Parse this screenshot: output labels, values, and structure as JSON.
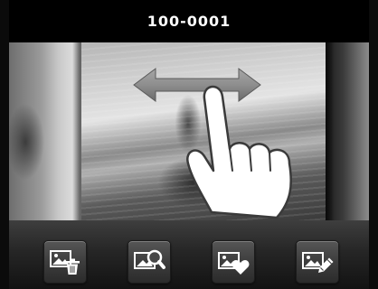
{
  "header": {
    "file_number": "100-0001"
  },
  "viewer": {
    "gesture": "swipe-left-right",
    "gesture_icons": [
      "double-arrow-icon",
      "pointing-hand-icon"
    ]
  },
  "toolbar": {
    "buttons": [
      {
        "name": "erase-image-button",
        "icon": "image-trash-icon"
      },
      {
        "name": "magnify-image-button",
        "icon": "image-magnify-icon"
      },
      {
        "name": "rate-image-button",
        "icon": "image-heart-icon"
      },
      {
        "name": "edit-image-button",
        "icon": "image-pencil-icon"
      }
    ]
  },
  "colors": {
    "background": "#000000",
    "title_text": "#ffffff",
    "button_face": "#474747",
    "icon": "#ffffff"
  }
}
